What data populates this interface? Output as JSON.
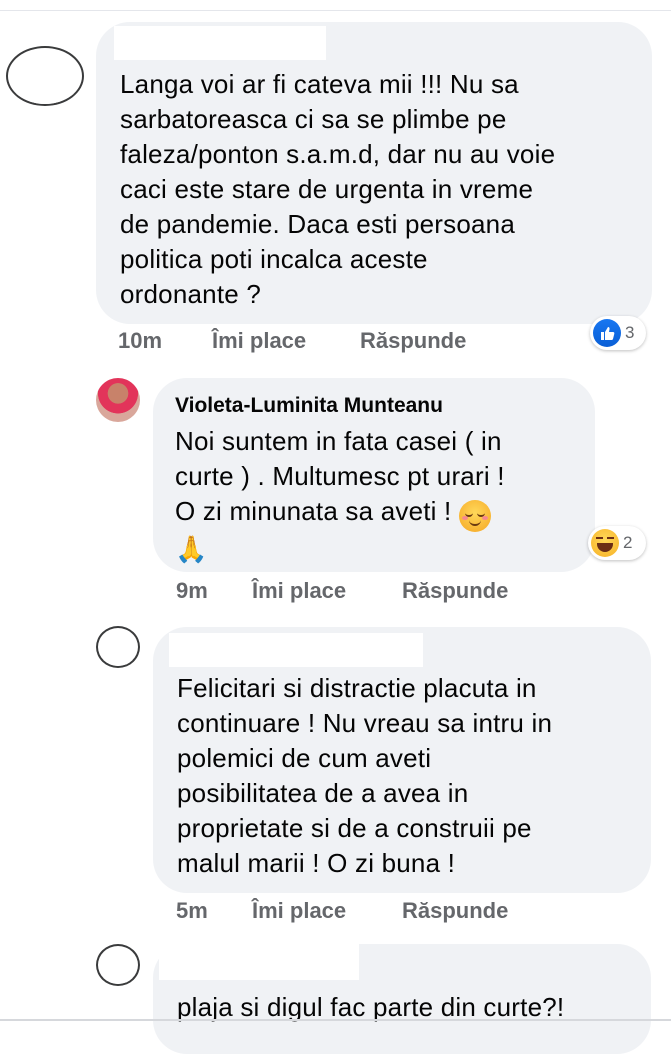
{
  "comments": [
    {
      "text": "Langa voi ar fi cateva mii !!! Nu sa\nsarbatoreasca ci sa se plimbe pe\nfaleza/ponton s.a.m.d, dar nu au voie\ncaci este stare de urgenta in vreme\nde pandemie. Daca esti persoana\npolitica poti incalca aceste\nordonante ?",
      "time": "10m",
      "like": "Îmi place",
      "reply": "Răspunde",
      "reaction": {
        "icon": "like-icon",
        "count": "3"
      }
    },
    {
      "author": "Violeta-Luminita Munteanu",
      "text": "Noi suntem in fata casei ( in\ncurte ) .  Multumesc pt urari !\nO zi minunata sa aveti !",
      "emoji_after": "smiling-face-icon",
      "emoji_line2": "🙏",
      "time": "9m",
      "like": "Îmi place",
      "reply": "Răspunde",
      "reaction": {
        "icon": "haha-icon",
        "count": "2"
      }
    },
    {
      "text": "Felicitari si distractie placuta in\ncontinuare ! Nu vreau sa intru in\npolemici de cum aveti\nposibilitatea de a avea in\nproprietate si de a construii pe\nmalul marii ! O zi buna !",
      "time": "5m",
      "like": "Îmi place",
      "reply": "Răspunde"
    },
    {
      "text": "plaja si digul fac parte din curte?!"
    }
  ],
  "colors": {
    "bubble": "#f0f2f5",
    "action_text": "#65676b",
    "like_blue": "#1877f2"
  }
}
